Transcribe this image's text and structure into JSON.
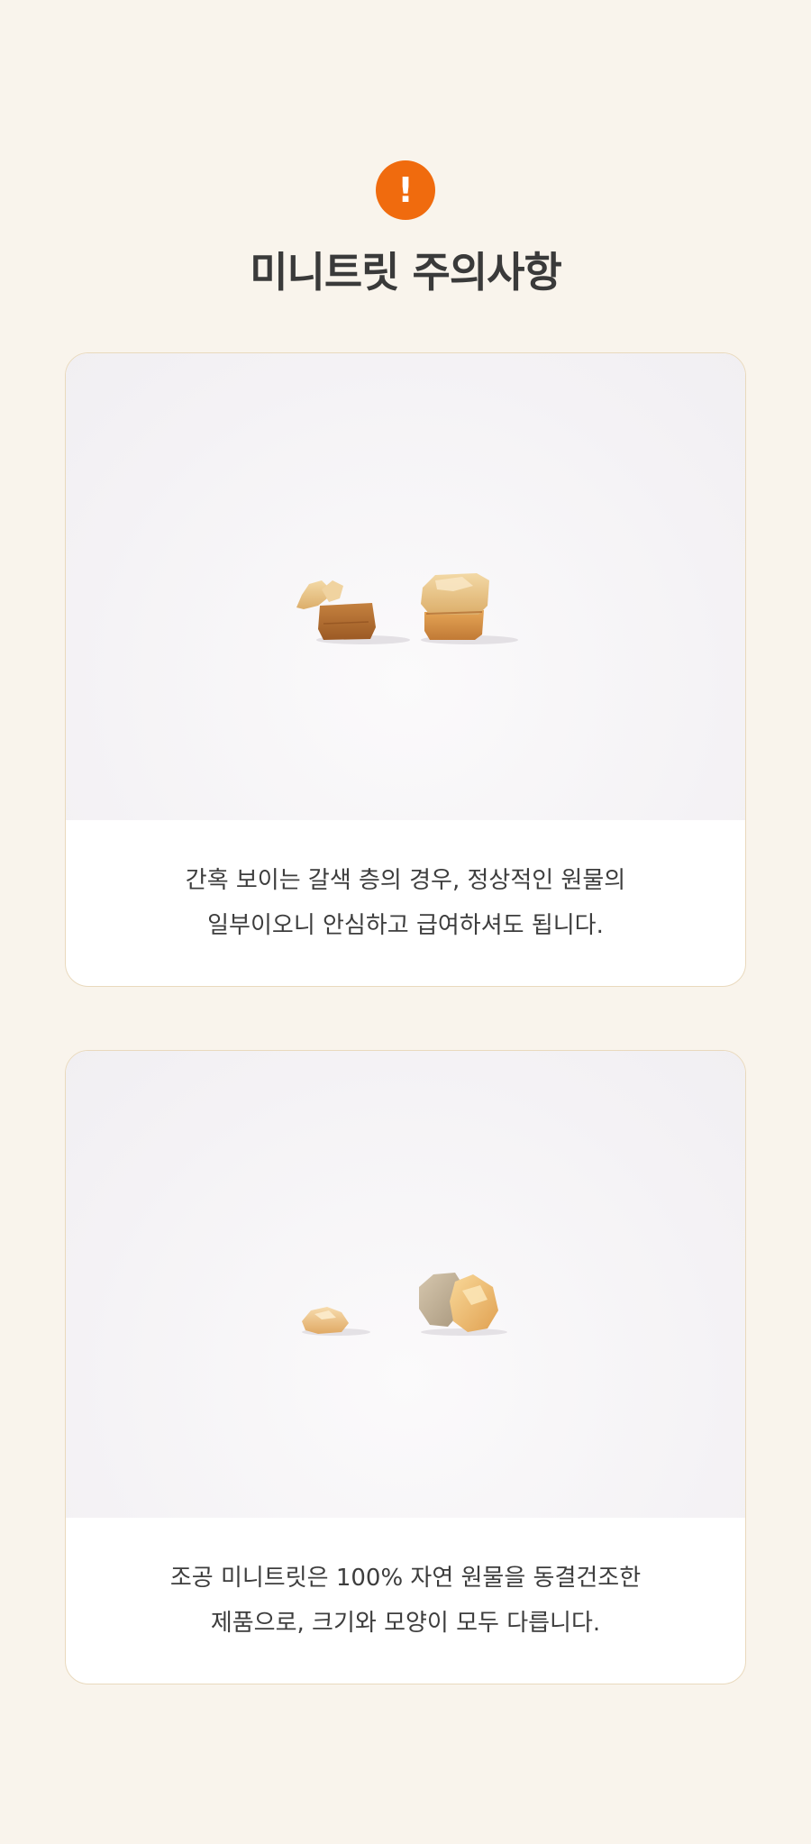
{
  "colors": {
    "background": "#f9f4ec",
    "accent": "#f06b0e",
    "card_border": "#e9d9bd",
    "text": "#3a3a3a"
  },
  "header": {
    "icon": "exclamation-icon",
    "icon_glyph": "!",
    "title": "미니트릿 주의사항"
  },
  "cards": [
    {
      "image": "freeze-dried-treat-brown-layer-photo",
      "caption_line1": "간혹 보이는 갈색 층의 경우, 정상적인 원물의",
      "caption_line2": "일부이오니 안심하고 급여하셔도 됩니다."
    },
    {
      "image": "freeze-dried-treat-size-shape-photo",
      "caption_line1": "조공 미니트릿은 100% 자연 원물을 동결건조한",
      "caption_line2": "제품으로, 크기와 모양이 모두 다릅니다."
    }
  ]
}
